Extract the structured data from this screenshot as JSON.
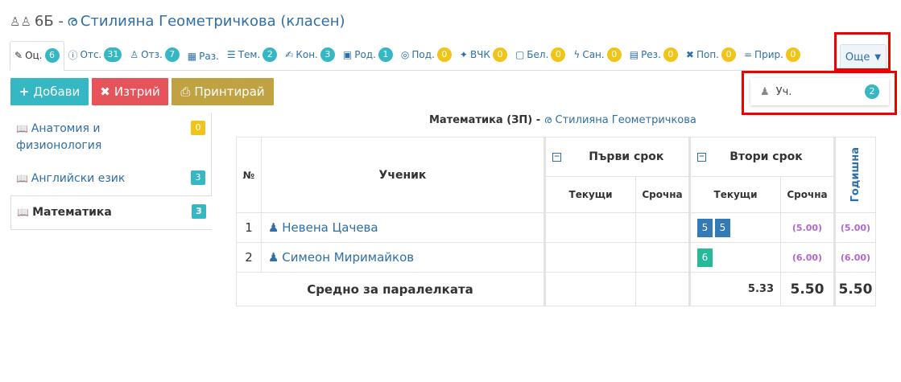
{
  "header": {
    "class_label": "6Б -",
    "teacher": "Стилияна Геометричкова (класен)"
  },
  "tabs": [
    {
      "label": "Оц.",
      "count": "6",
      "icon": "✎",
      "color": "teal"
    },
    {
      "label": "Отс.",
      "count": "31",
      "icon": "ⓘ",
      "color": "teal"
    },
    {
      "label": "Отз.",
      "count": "7",
      "icon": "♙",
      "color": "teal"
    },
    {
      "label": "Раз.",
      "icon": "▦"
    },
    {
      "label": "Тем.",
      "count": "2",
      "icon": "☰",
      "color": "teal"
    },
    {
      "label": "Кон.",
      "count": "3",
      "icon": "✍",
      "color": "teal"
    },
    {
      "label": "Род.",
      "count": "1",
      "icon": "▣",
      "color": "teal"
    },
    {
      "label": "Под.",
      "count": "0",
      "icon": "◎",
      "color": "yellow"
    },
    {
      "label": "ВЧК",
      "count": "0",
      "icon": "✦",
      "color": "yellow"
    },
    {
      "label": "Бел.",
      "count": "0",
      "icon": "▢",
      "color": "yellow"
    },
    {
      "label": "Сан.",
      "count": "0",
      "icon": "ϟ",
      "color": "yellow"
    },
    {
      "label": "Рез.",
      "count": "0",
      "icon": "▤",
      "color": "yellow"
    },
    {
      "label": "Поп.",
      "count": "0",
      "icon": "✖",
      "color": "yellow"
    },
    {
      "label": "Прир.",
      "count": "0",
      "icon": "=",
      "color": "yellow"
    }
  ],
  "more_button": "Още",
  "dropdown": {
    "label": "Уч.",
    "count": "2"
  },
  "actions": {
    "add": "Добави",
    "delete": "Изтрий",
    "print": "Принтирай"
  },
  "colors": {
    "add": "#36b7c4",
    "delete": "#e5535b",
    "print": "#c0a243",
    "link": "#2f6fa7",
    "highlight": "#e00000"
  },
  "subjects": [
    {
      "label": "Анатомия и физионология",
      "count": "0",
      "color": "yellow"
    },
    {
      "label": "Английски език",
      "count": "3",
      "color": "teal"
    },
    {
      "label": "Математика",
      "count": "3",
      "color": "teal",
      "active": true
    }
  ],
  "caption": {
    "subject": "Математика (ЗП) -",
    "teacher": "Стилияна Геометричкова"
  },
  "table": {
    "col_no": "№",
    "col_student": "Ученик",
    "term1": "Първи срок",
    "term2": "Втори срок",
    "annual": "Годишна",
    "current": "Текущи",
    "term_grade": "Срочна",
    "rows": [
      {
        "no": "1",
        "name": "Невена Цачева",
        "t2_current": [
          "5",
          "5"
        ],
        "t2_term": "(5.00)",
        "annual": "(5.00)"
      },
      {
        "no": "2",
        "name": "Симеон Миримайков",
        "t2_current": [
          "6"
        ],
        "t2_term": "(6.00)",
        "annual": "(6.00)"
      }
    ],
    "avg_label": "Средно за паралелката",
    "avg_t2_current": "5.33",
    "avg_t2_term": "5.50",
    "avg_annual": "5.50"
  }
}
